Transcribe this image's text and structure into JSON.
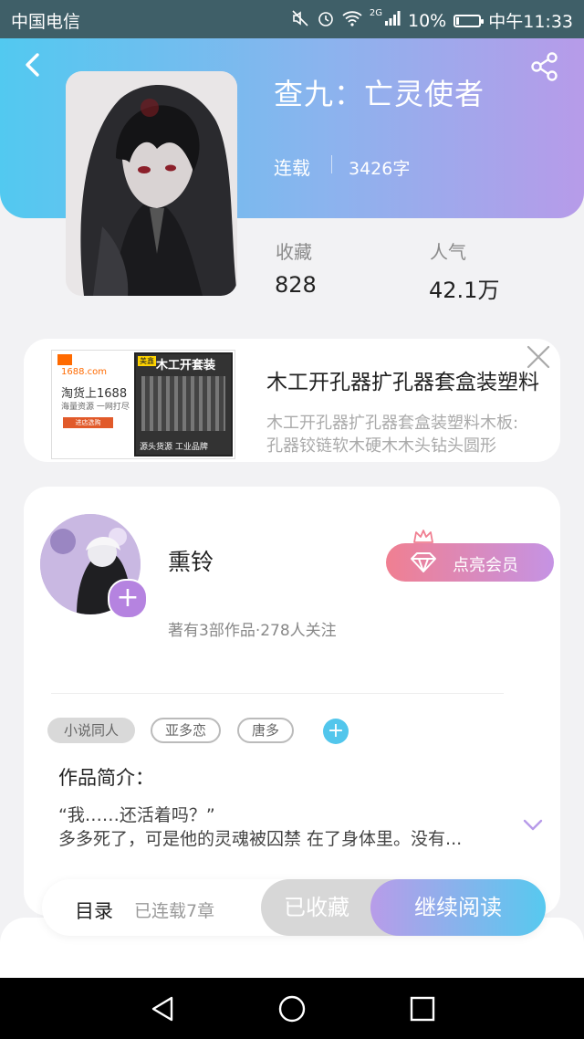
{
  "status_bar": {
    "carrier": "中国电信",
    "battery_text": "10%",
    "time": "中午11:33",
    "signal_label": "2G"
  },
  "book": {
    "title": "查九：亡灵使者",
    "status": "连载",
    "word_count": "3426字",
    "stats": [
      {
        "label": "收藏",
        "value": "828"
      },
      {
        "label": "人气",
        "value": "42.1万"
      }
    ]
  },
  "ad": {
    "title": "木工开孔器扩孔器套盒装塑料",
    "description_line1": "木工开孔器扩孔器套盒装塑料木板:",
    "description_line2": "孔器铰链软木硬木木头钻头圆形",
    "image_text": {
      "site": "1688.com",
      "slogan": "淘货上1688",
      "sub": "海量资源 一网打尽",
      "button": "进店选购",
      "brand": "美鑫",
      "heading": "木工开套装",
      "footer": "源头货源 工业品牌"
    }
  },
  "author": {
    "name": "熏铃",
    "meta": "著有3部作品·278人关注",
    "vip_button": "点亮会员"
  },
  "tags": [
    "小说同人",
    "亚多恋",
    "唐多"
  ],
  "intro": {
    "heading": "作品简介：",
    "line1": "“我……还活着吗？”",
    "line2": "多多死了，可是他的灵魂被囚禁 在了身体里。没有..."
  },
  "bottom_bar": {
    "toc": "目录",
    "chapters": "已连载7章",
    "saved_button": "已收藏",
    "read_button": "继续阅读"
  },
  "colors": {
    "header_gradient_start": "#52c9f0",
    "header_gradient_end": "#b79be9",
    "vip_gradient_start": "#f07f91",
    "vip_gradient_end": "#c593e4",
    "accent_purple": "#b583e0",
    "accent_blue": "#52c6ec"
  }
}
